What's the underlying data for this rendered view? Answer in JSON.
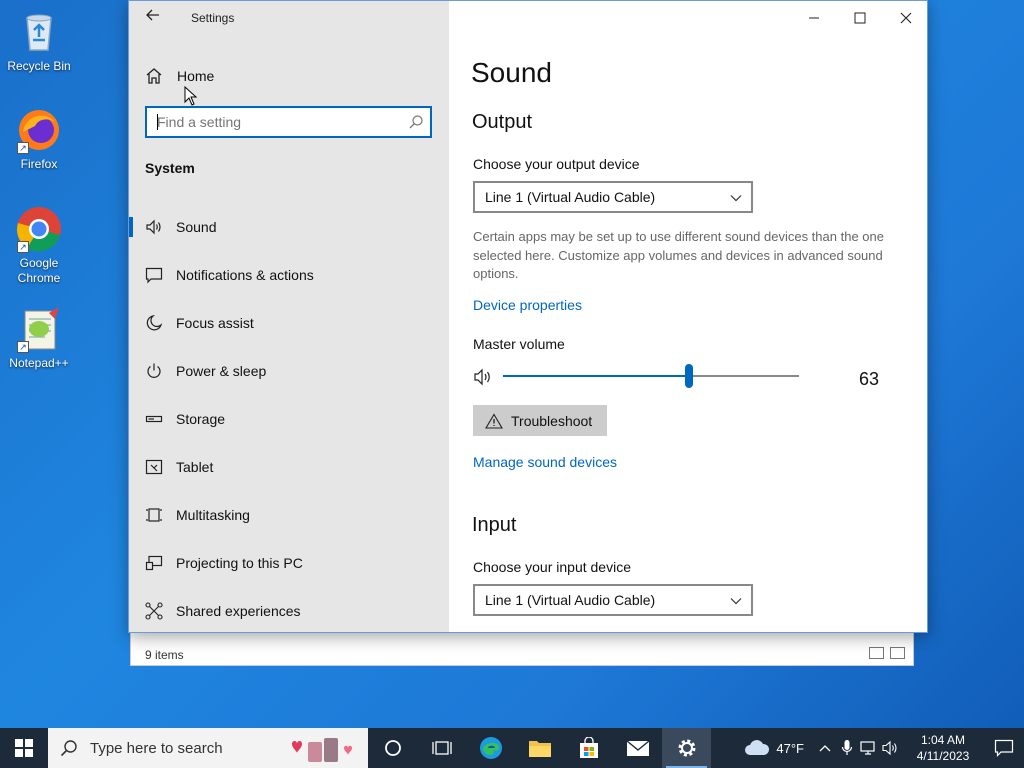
{
  "desktop": {
    "icons": [
      {
        "label": "Recycle Bin"
      },
      {
        "label": "Firefox"
      },
      {
        "label": "Google Chrome"
      },
      {
        "label": "Notepad++"
      }
    ]
  },
  "explorer": {
    "status": "9 items"
  },
  "settings_window": {
    "title": "Settings",
    "sidebar": {
      "home_label": "Home",
      "search_placeholder": "Find a setting",
      "section": "System",
      "items": [
        {
          "label": "Sound",
          "icon": "speaker-icon",
          "active": true
        },
        {
          "label": "Notifications & actions",
          "icon": "notification-icon"
        },
        {
          "label": "Focus assist",
          "icon": "moon-icon"
        },
        {
          "label": "Power & sleep",
          "icon": "power-icon"
        },
        {
          "label": "Storage",
          "icon": "storage-icon"
        },
        {
          "label": "Tablet",
          "icon": "tablet-icon"
        },
        {
          "label": "Multitasking",
          "icon": "multitasking-icon"
        },
        {
          "label": "Projecting to this PC",
          "icon": "projecting-icon"
        },
        {
          "label": "Shared experiences",
          "icon": "shared-icon"
        }
      ]
    },
    "content": {
      "page_title": "Sound",
      "output": {
        "heading": "Output",
        "device_label": "Choose your output device",
        "device_value": "Line 1 (Virtual Audio Cable)",
        "description": "Certain apps may be set up to use different sound devices than the one selected here. Customize app volumes and devices in advanced sound options.",
        "device_properties_link": "Device properties",
        "volume_label": "Master volume",
        "volume_value": "63",
        "troubleshoot_label": "Troubleshoot",
        "manage_link": "Manage sound devices"
      },
      "input": {
        "heading": "Input",
        "device_label": "Choose your input device",
        "device_value": "Line 1 (Virtual Audio Cable)"
      }
    }
  },
  "taskbar": {
    "search_placeholder": "Type here to search",
    "weather": "47°F",
    "time": "1:04 AM",
    "date": "4/11/2023"
  },
  "colors": {
    "accent": "#0067c0",
    "sidebar_bg": "#e6e6e6",
    "taskbar_bg": "#1c2a3a"
  }
}
